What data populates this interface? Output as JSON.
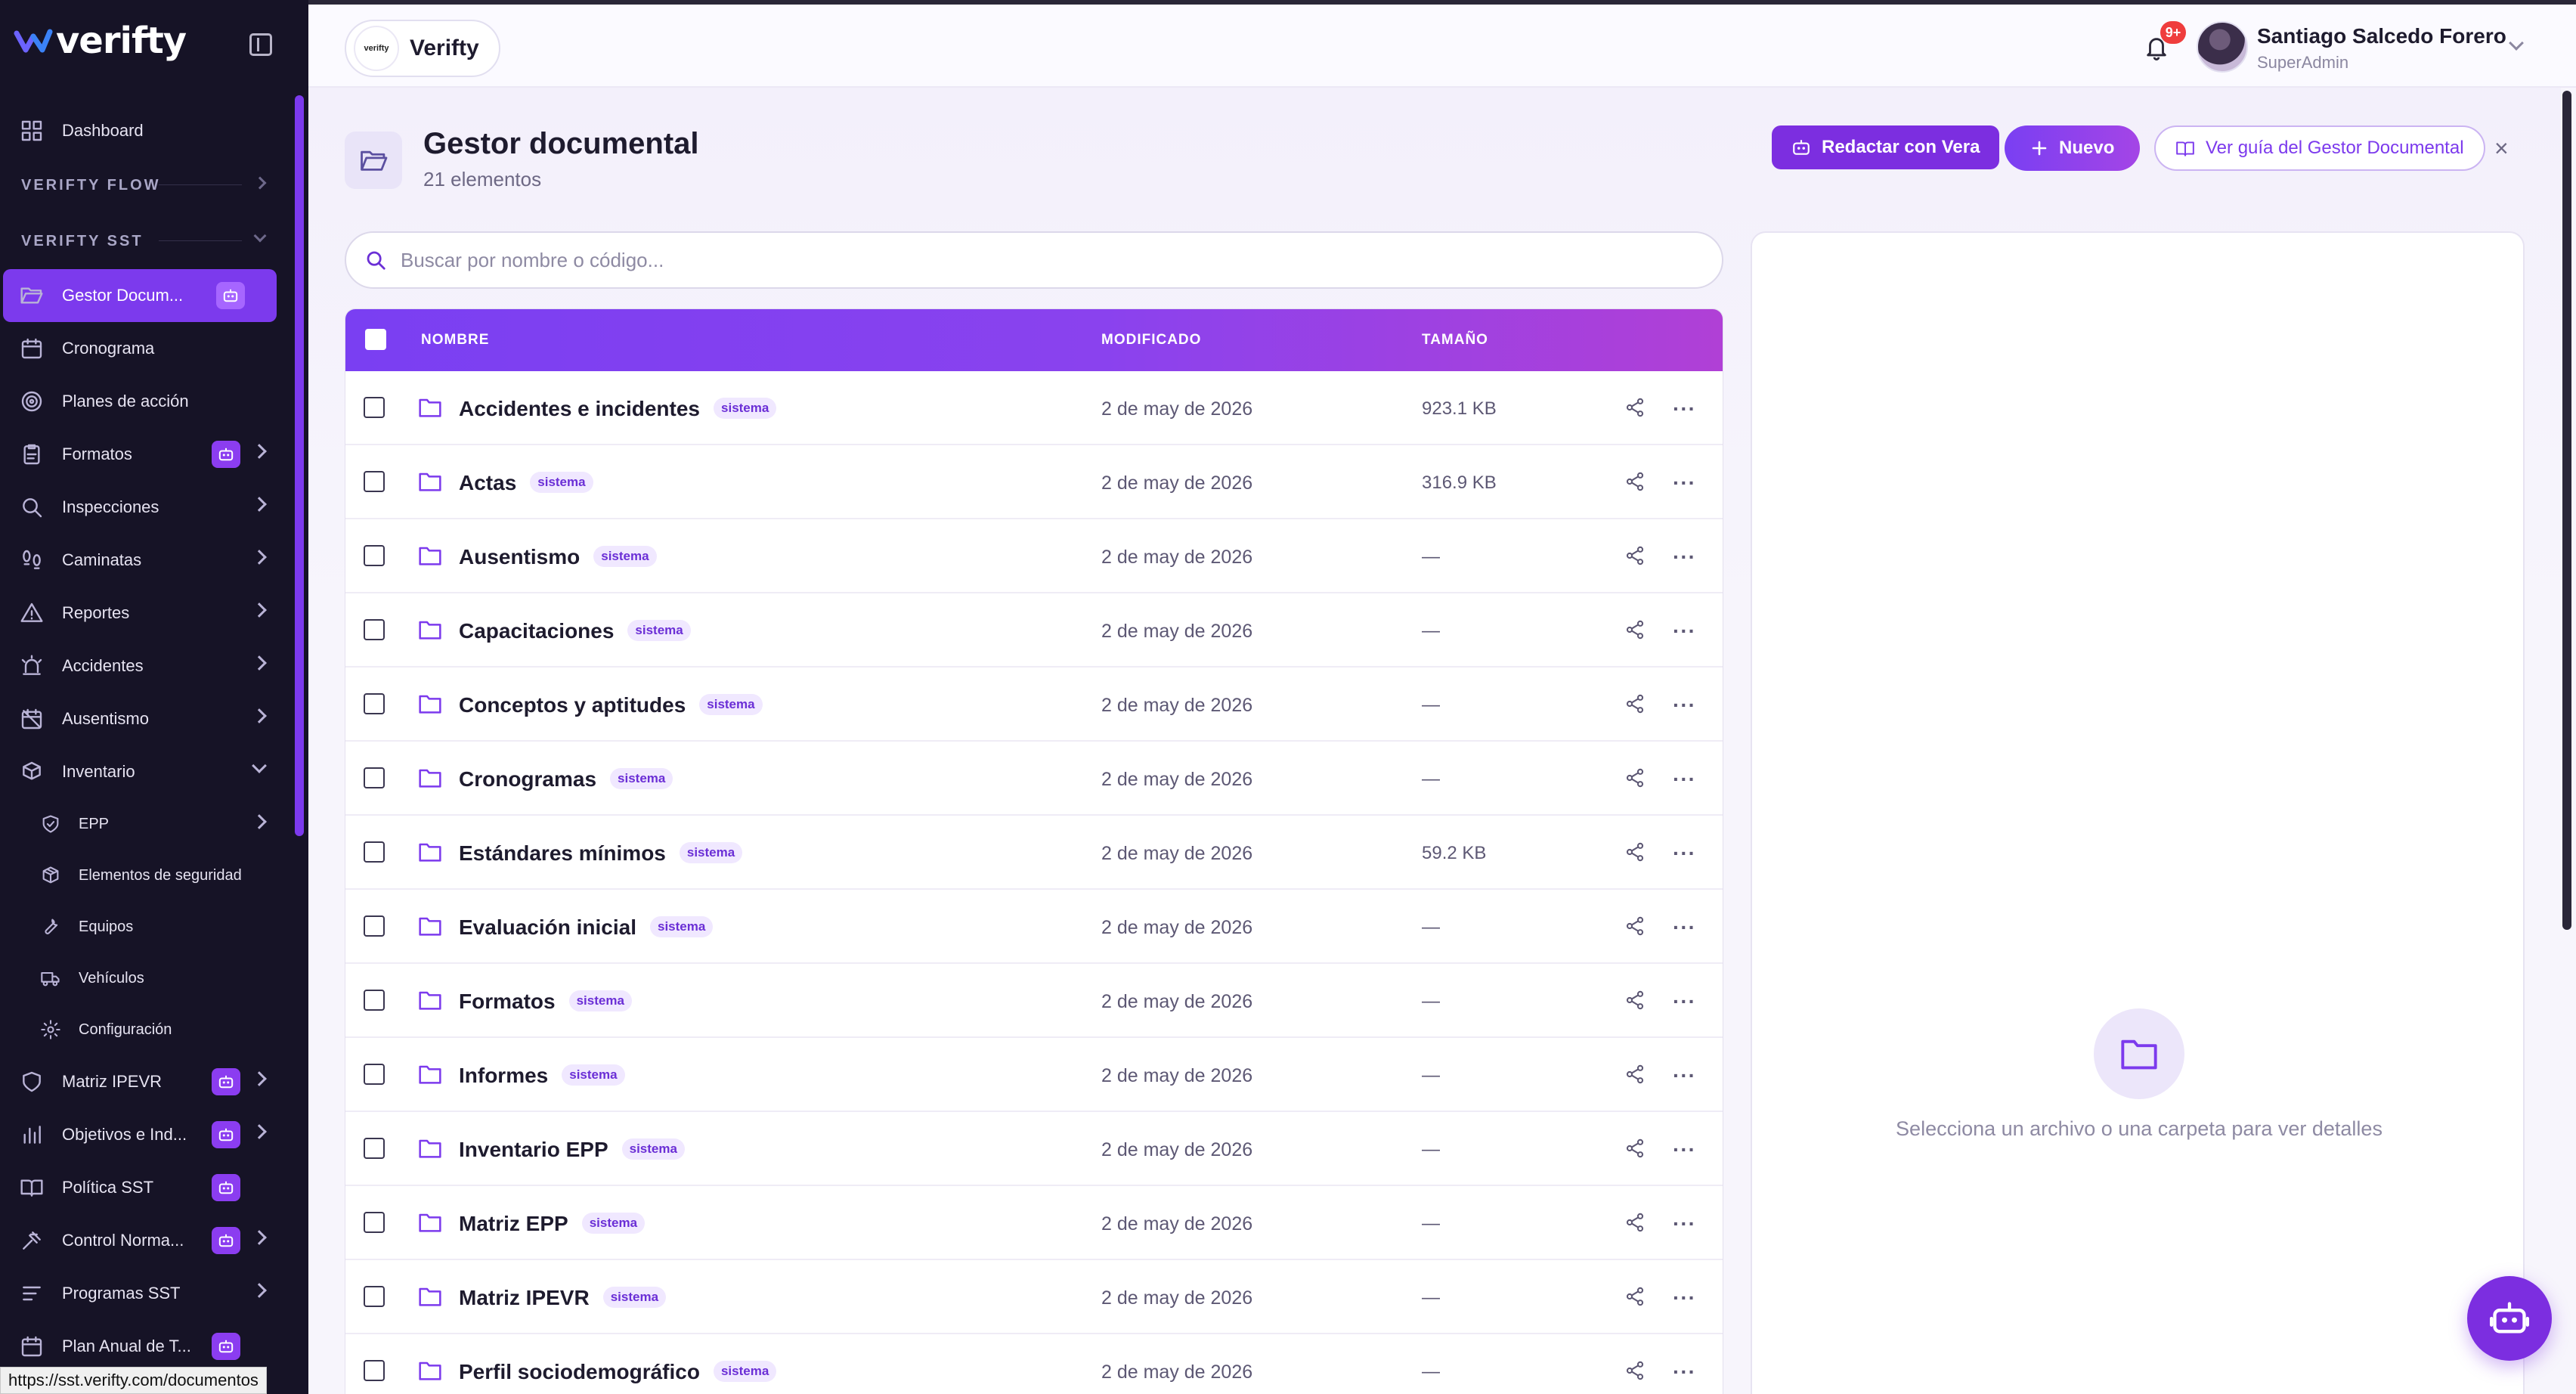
{
  "brand": {
    "name": "verifty"
  },
  "sidebar": {
    "items": [
      {
        "label": "Dashboard",
        "icon": "dashboard-grid-icon"
      },
      {
        "section": "VERIFTY FLOW"
      },
      {
        "section": "VERIFTY SST"
      },
      {
        "label": "Gestor Docum...",
        "icon": "folder-open-icon",
        "active": true,
        "bot": true
      },
      {
        "label": "Cronograma",
        "icon": "calendar-icon"
      },
      {
        "label": "Planes de acción",
        "icon": "target-icon"
      },
      {
        "label": "Formatos",
        "icon": "clipboard-icon",
        "bot": true,
        "chevron": true
      },
      {
        "label": "Inspecciones",
        "icon": "search-icon",
        "chevron": true
      },
      {
        "label": "Caminatas",
        "icon": "footprints-icon",
        "chevron": true
      },
      {
        "label": "Reportes",
        "icon": "warning-triangle-icon",
        "chevron": true
      },
      {
        "label": "Accidentes",
        "icon": "siren-icon",
        "chevron": true
      },
      {
        "label": "Ausentismo",
        "icon": "calendar-off-icon",
        "chevron": true
      },
      {
        "label": "Inventario",
        "icon": "boxes-icon",
        "chevron": "down"
      },
      {
        "label": "EPP",
        "icon": "shield-check-icon",
        "sub": true,
        "chevron": true
      },
      {
        "label": "Elementos de seguridad",
        "icon": "package-icon",
        "sub": true
      },
      {
        "label": "Equipos",
        "icon": "wrench-icon",
        "sub": true
      },
      {
        "label": "Vehículos",
        "icon": "truck-icon",
        "sub": true
      },
      {
        "label": "Configuración",
        "icon": "gear-icon",
        "sub": true
      },
      {
        "label": "Matriz IPEVR",
        "icon": "shield-icon",
        "bot": true,
        "chevron": true
      },
      {
        "label": "Objetivos e Ind...",
        "icon": "bar-chart-icon",
        "bot": true,
        "chevron": true
      },
      {
        "label": "Política SST",
        "icon": "book-open-icon",
        "bot": true
      },
      {
        "label": "Control Norma...",
        "icon": "gavel-icon",
        "bot": true,
        "chevron": true
      },
      {
        "label": "Programas SST",
        "icon": "list-icon",
        "chevron": true
      },
      {
        "label": "Plan Anual de T...",
        "icon": "calendar-icon",
        "bot": true
      }
    ]
  },
  "status_url": "https://sst.verifty.com/documentos",
  "topbar": {
    "org_name": "Verifty",
    "org_logo_text": "verifty",
    "notifications_badge": "9+",
    "user_name": "Santiago Salcedo Forero",
    "user_role": "SuperAdmin"
  },
  "page": {
    "title": "Gestor documental",
    "subtitle": "21 elementos",
    "btn_vera": "Redactar con Vera",
    "btn_new": "Nuevo",
    "btn_guide": "Ver guía del Gestor Documental",
    "close": "×"
  },
  "search": {
    "placeholder": "Buscar por nombre o código..."
  },
  "table": {
    "columns": {
      "name": "NOMBRE",
      "modified": "MODIFICADO",
      "size": "TAMAÑO"
    },
    "rows": [
      {
        "name": "Accidentes e incidentes",
        "tag": "sistema",
        "modified": "2 de may de 2026",
        "size": "923.1 KB"
      },
      {
        "name": "Actas",
        "tag": "sistema",
        "modified": "2 de may de 2026",
        "size": "316.9 KB"
      },
      {
        "name": "Ausentismo",
        "tag": "sistema",
        "modified": "2 de may de 2026",
        "size": "—"
      },
      {
        "name": "Capacitaciones",
        "tag": "sistema",
        "modified": "2 de may de 2026",
        "size": "—"
      },
      {
        "name": "Conceptos y aptitudes",
        "tag": "sistema",
        "modified": "2 de may de 2026",
        "size": "—"
      },
      {
        "name": "Cronogramas",
        "tag": "sistema",
        "modified": "2 de may de 2026",
        "size": "—"
      },
      {
        "name": "Estándares mínimos",
        "tag": "sistema",
        "modified": "2 de may de 2026",
        "size": "59.2 KB"
      },
      {
        "name": "Evaluación inicial",
        "tag": "sistema",
        "modified": "2 de may de 2026",
        "size": "—"
      },
      {
        "name": "Formatos",
        "tag": "sistema",
        "modified": "2 de may de 2026",
        "size": "—"
      },
      {
        "name": "Informes",
        "tag": "sistema",
        "modified": "2 de may de 2026",
        "size": "—"
      },
      {
        "name": "Inventario EPP",
        "tag": "sistema",
        "modified": "2 de may de 2026",
        "size": "—"
      },
      {
        "name": "Matriz EPP",
        "tag": "sistema",
        "modified": "2 de may de 2026",
        "size": "—"
      },
      {
        "name": "Matriz IPEVR",
        "tag": "sistema",
        "modified": "2 de may de 2026",
        "size": "—"
      },
      {
        "name": "Perfil sociodemográfico",
        "tag": "sistema",
        "modified": "2 de may de 2026",
        "size": "—"
      }
    ]
  },
  "detail": {
    "empty_text": "Selecciona un archivo o una carpeta para ver detalles"
  },
  "colors": {
    "accent": "#7c3aed",
    "sidebar_bg": "#161326",
    "header_gradient_start": "#7a3ff2",
    "header_gradient_end": "#b040d6"
  }
}
